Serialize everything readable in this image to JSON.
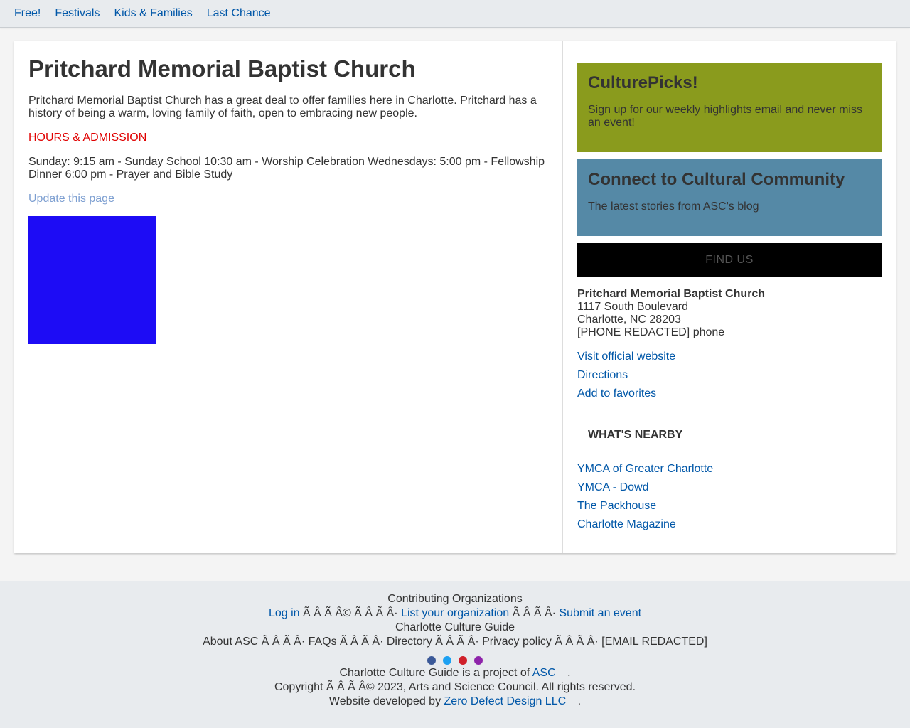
{
  "topnav": [
    "Free!",
    "Festivals",
    "Kids & Families",
    "Last Chance"
  ],
  "main": {
    "title": "Pritchard Memorial Baptist Church",
    "description": "Pritchard Memorial Baptist Church has a great deal to offer families here in Charlotte. Pritchard has a history of being a warm, loving family of faith, open to embracing new people.",
    "hours_heading": "HOURS & ADMISSION",
    "hours": "Sunday: 9:15 am - Sunday School 10:30 am - Worship Celebration Wednesdays: 5:00 pm - Fellowship Dinner 6:00 pm - Prayer and Bible Study",
    "update_link": "Update this page",
    "media_color": "#1d0cf5"
  },
  "sidebar": {
    "culturepicks": {
      "title": "CulturePicks!",
      "text": "Sign up for our weekly highlights email and never miss an event!",
      "color": "#8a9b1d"
    },
    "connect": {
      "title": "Connect to Cultural Community",
      "text": "The latest stories from ASC's blog",
      "color": "#5589a6"
    },
    "findus": "FIND US",
    "address": {
      "name": "Pritchard Memorial Baptist Church",
      "street": "1117 South Boulevard",
      "city": "Charlotte, NC 28203",
      "phone": "[PHONE REDACTED] phone"
    },
    "links": [
      "Visit official website",
      "Directions",
      "Add to favorites"
    ],
    "nearby_heading": "WHAT'S NEARBY",
    "nearby": [
      "YMCA of Greater Charlotte",
      "YMCA - Dowd",
      "The Packhouse",
      "Charlotte Magazine"
    ]
  },
  "footer": {
    "contrib_heading": "Contributing Organizations",
    "login": "Log in",
    "sep1": "Ã   Â   Ã   Â© Ã   Â   Ã   Â·",
    "list_org": "List your organization",
    "sep2": "Ã   Â   Ã   Â·",
    "submit_event": "Submit an event",
    "guide_heading": "Charlotte Culture Guide",
    "guide_links": "About ASC Ã   Â   Ã   Â· FAQs Ã   Â   Ã   Â· Directory Ã   Â   Ã   Â· Privacy policy Ã   Â   Ã   Â· [EMAIL REDACTED]",
    "social_colors": [
      "#3b5998",
      "#1da1f2",
      "#d0202a",
      "#8e24aa"
    ],
    "project_prefix": "Charlotte Culture Guide is a project of",
    "project_link": "ASC",
    "period": ".",
    "copyright": "Copyright Ã   Â   Ã   Â© 2023, Arts and Science Council. All rights reserved.",
    "developed_prefix": "Website developed by",
    "developed_link": "Zero Defect Design LLC"
  }
}
